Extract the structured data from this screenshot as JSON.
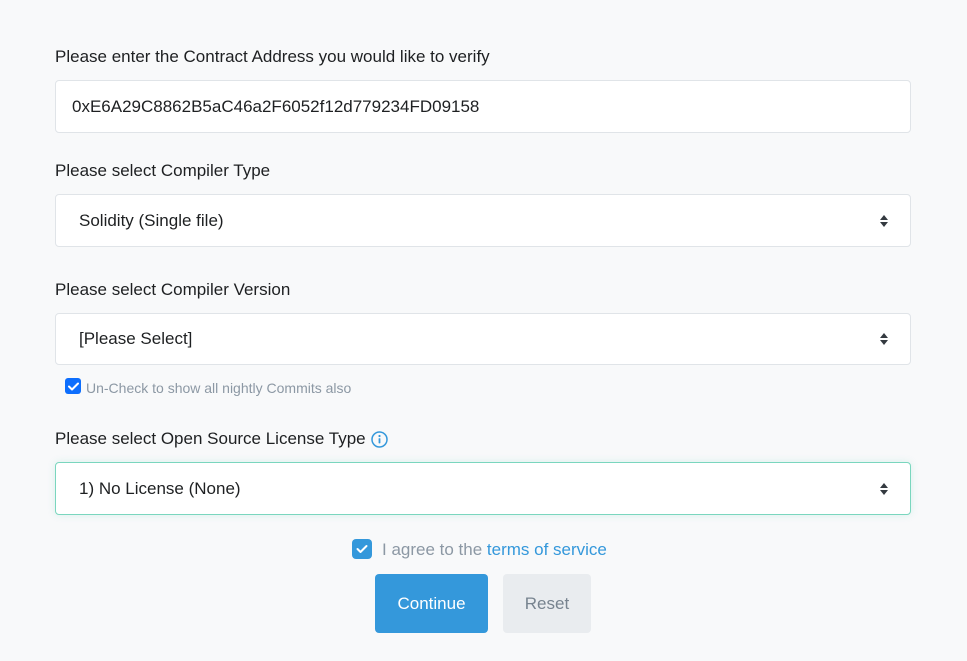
{
  "contract": {
    "label": "Please enter the Contract Address you would like to verify",
    "value": "0xE6A29C8862B5aC46a2F6052f12d779234FD09158"
  },
  "compiler_type": {
    "label": "Please select Compiler Type",
    "selected": "Solidity (Single file)"
  },
  "compiler_version": {
    "label": "Please select Compiler Version",
    "selected": "[Please Select]",
    "nightly_checkbox_label": "Un-Check to show all nightly Commits also",
    "nightly_checked": true
  },
  "license": {
    "label": "Please select Open Source License Type",
    "info_icon": "info-circle-icon",
    "selected": "1) No License (None)"
  },
  "agree": {
    "prefix": "I agree to the",
    "link_text": "terms of service",
    "checked": true
  },
  "buttons": {
    "continue_label": "Continue",
    "reset_label": "Reset"
  },
  "colors": {
    "accent": "#3498db",
    "checkbox_blue": "#0d6efd",
    "focus_border": "#7ad6be",
    "muted_text": "#8c98a4"
  }
}
